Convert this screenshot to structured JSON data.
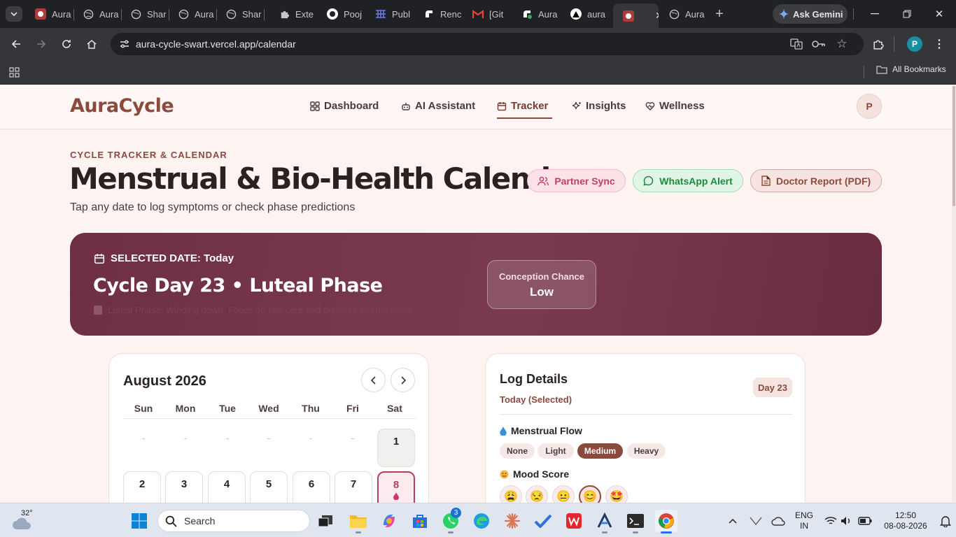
{
  "browser": {
    "tabs": [
      {
        "label": "Aura"
      },
      {
        "label": "Aura"
      },
      {
        "label": "Shar"
      },
      {
        "label": "Aura"
      },
      {
        "label": "Shar"
      },
      {
        "label": "Exte"
      },
      {
        "label": "Pooj"
      },
      {
        "label": "Publ"
      },
      {
        "label": "Renc"
      },
      {
        "label": "[Git"
      },
      {
        "label": "Aura"
      },
      {
        "label": "aura"
      },
      {
        "label": ""
      },
      {
        "label": "Aura"
      }
    ],
    "ask_gemini": "Ask Gemini",
    "url": "aura-cycle-swart.vercel.app/calendar",
    "profile_initial": "P",
    "all_bookmarks": "All Bookmarks"
  },
  "app": {
    "brand": "AuraCycle",
    "nav": [
      {
        "label": "Dashboard",
        "icon": "grid-icon"
      },
      {
        "label": "AI Assistant",
        "icon": "bot-icon"
      },
      {
        "label": "Tracker",
        "icon": "calendar-icon"
      },
      {
        "label": "Insights",
        "icon": "sparkle-icon"
      },
      {
        "label": "Wellness",
        "icon": "heart-icon"
      }
    ],
    "active_nav": "Tracker",
    "avatar": "P",
    "eyebrow": "CYCLE TRACKER & CALENDAR",
    "title": "Menstrual & Bio-Health Calendar",
    "subtitle": "Tap any date to log symptoms or check phase predictions",
    "actions": {
      "partner": "Partner Sync",
      "whatsapp": "WhatsApp Alert",
      "doctor": "Doctor Report (PDF)"
    },
    "hero": {
      "selected": "SELECTED DATE: Today",
      "cycle": "Cycle Day 23 • Luteal Phase",
      "tip": "Luteal Phase: Winding down. Focus on self-care and prioritize deeper sleep.",
      "conception_label": "Conception Chance",
      "conception_value": "Low"
    },
    "calendar": {
      "month": "August 2026",
      "weekdays": [
        "Sun",
        "Mon",
        "Tue",
        "Wed",
        "Thu",
        "Fri",
        "Sat"
      ],
      "blank": "-",
      "row1": [
        "1"
      ],
      "row2": [
        "2",
        "3",
        "4",
        "5",
        "6",
        "7",
        "8"
      ],
      "period_marker": "💧"
    },
    "log": {
      "title": "Log Details",
      "subtitle": "Today (Selected)",
      "day_badge": "Day 23",
      "flow_label": "Menstrual Flow",
      "flow_options": [
        "None",
        "Light",
        "Medium",
        "Heavy"
      ],
      "flow_selected": "Medium",
      "mood_label": "Mood Score",
      "mood_options": [
        "😩",
        "😒",
        "😐",
        "😊",
        "🤩"
      ],
      "mood_selected": "😊"
    }
  },
  "taskbar": {
    "weather_temp": "32°",
    "search": "Search",
    "whatsapp_badge": "3",
    "lang_line1": "ENG",
    "lang_line2": "IN",
    "time": "12:50",
    "date": "08-08-2026"
  }
}
